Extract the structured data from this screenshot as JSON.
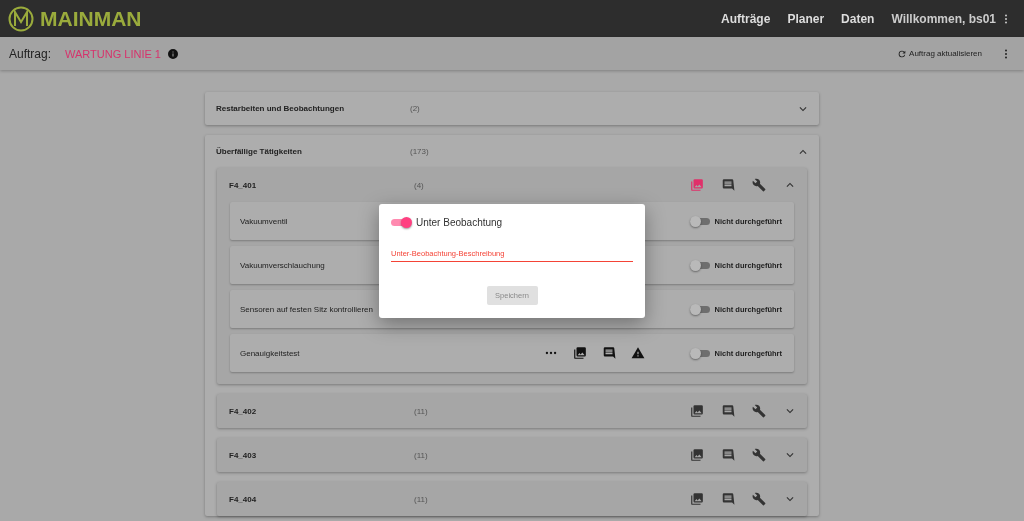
{
  "app": {
    "logo_text": "MAINMAN",
    "nav": [
      "Aufträge",
      "Planer",
      "Daten"
    ],
    "user": "Willkommen, bs01"
  },
  "toolbar": {
    "label": "Auftrag:",
    "order": "WARTUNG LINIE 1",
    "refresh": "Auftrag aktualisieren"
  },
  "sections": [
    {
      "title": "Restarbeiten und Beobachtungen",
      "count": "(2)",
      "expanded": false
    },
    {
      "title": "Überfällige Tätigkeiten",
      "count": "(173)",
      "expanded": true,
      "groups": [
        {
          "title": "F4_401",
          "count": "(4)",
          "expanded": true,
          "photos_highlighted": true,
          "tasks": [
            {
              "name": "Vakuumventil",
              "status": "Nicht durchgeführt",
              "on": false
            },
            {
              "name": "Vakuumverschlauchung",
              "status": "Nicht durchgeführt",
              "on": false
            },
            {
              "name": "Sensoren auf festen Sitz kontrollieren",
              "status": "Nicht durchgeführt",
              "on": false
            },
            {
              "name": "Genauigkeitstest",
              "status": "Nicht durchgeführt",
              "on": false,
              "icons": [
                {
                  "kind": "more"
                },
                {
                  "kind": "photos"
                },
                {
                  "kind": "comment"
                },
                {
                  "kind": "warning"
                }
              ]
            }
          ]
        },
        {
          "title": "F4_402",
          "count": "(11)",
          "expanded": false,
          "photos_highlighted": false
        },
        {
          "title": "F4_403",
          "count": "(11)",
          "expanded": false,
          "photos_highlighted": false
        },
        {
          "title": "F4_404",
          "count": "(11)",
          "expanded": false,
          "photos_highlighted": false
        }
      ]
    }
  ],
  "dialog": {
    "toggle_label": "Unter Beobachtung",
    "on": true,
    "placeholder": "Unter-Beobachtung-Beschreibung",
    "invalid": true,
    "button": "Speichern",
    "button_disabled": true
  }
}
